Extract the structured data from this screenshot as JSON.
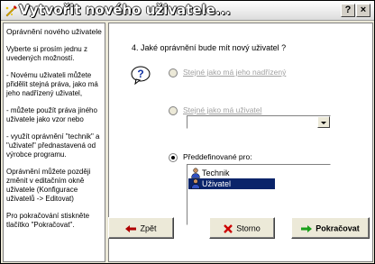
{
  "window": {
    "title": "Vytvořit nového uživatele...",
    "help_label": "?",
    "close_label": "×"
  },
  "sidebar": {
    "paragraphs": [
      "Oprávnění nového uživatele",
      "Vyberte si prosím jednu z uvedených možností.",
      "- Novému uživateli můžete přidělit stejná práva, jako má jeho nadřízený uživatel,",
      "- můžete použít práva jiného uživatele jako vzor nebo",
      "- využít oprávnění \"technik\" a \"uživatel\" přednastavená od výrobce programu.",
      "Oprávnění můžete později změnit v editačním okně uživatele (Konfigurace uživatelů -> Editovat)",
      "Pro pokračování stiskněte tlačítko \"Pokračovat\"."
    ]
  },
  "main": {
    "question": "4. Jaké oprávnění bude mít nový uživatel ?",
    "options": {
      "same_as_supervisor": {
        "label": "Stejné jako má jeho nadřízený",
        "selected": false,
        "enabled": false
      },
      "same_as_user": {
        "label": "Stejné jako má uživatel",
        "selected": false,
        "enabled": false
      },
      "predefined": {
        "label": "Předdefinované pro:",
        "selected": true,
        "enabled": true
      }
    },
    "user_combo_value": "",
    "predefined_list": [
      {
        "label": "Technik",
        "selected": false
      },
      {
        "label": "Uživatel",
        "selected": true
      }
    ]
  },
  "buttons": {
    "back": "Zpět",
    "cancel": "Storno",
    "next": "Pokračovat"
  },
  "colors": {
    "selection": "#0a246a",
    "face": "#ece9d8",
    "next_arrow": "#1aa01a",
    "cancel_x": "#cc0000",
    "back_arrow": "#b00000"
  }
}
